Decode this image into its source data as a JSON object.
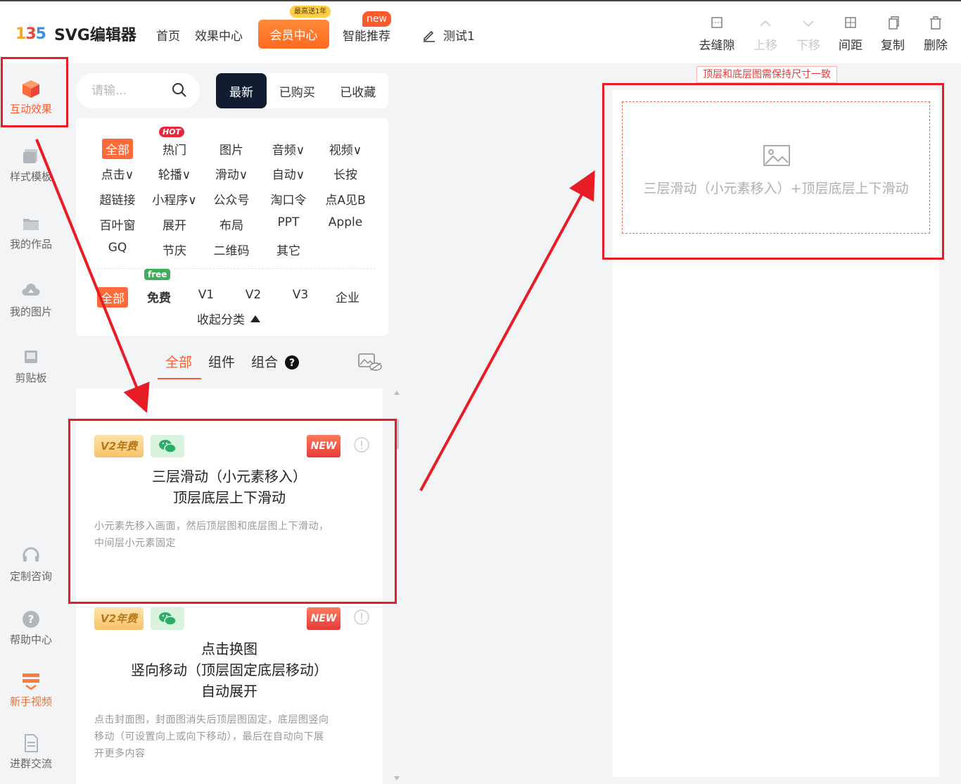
{
  "header": {
    "logo_mark": [
      "1",
      "3",
      "5"
    ],
    "logo_text": "SVG编辑器",
    "nav": [
      "首页",
      "效果中心"
    ],
    "vip_label": "会员中心",
    "vip_tag": "最高送1年",
    "smart_label": "智能推荐",
    "new_tag": "new",
    "doc_title": "测试1",
    "tools": [
      {
        "label": "去缝隙",
        "icon": "gap-icon",
        "enabled": true
      },
      {
        "label": "上移",
        "icon": "chevron-up-icon",
        "enabled": false
      },
      {
        "label": "下移",
        "icon": "chevron-down-icon",
        "enabled": false
      },
      {
        "label": "间距",
        "icon": "spacing-icon",
        "enabled": true
      },
      {
        "label": "复制",
        "icon": "copy-icon",
        "enabled": true
      },
      {
        "label": "删除",
        "icon": "trash-icon",
        "enabled": true
      }
    ]
  },
  "rail": {
    "items": [
      {
        "label": "互动效果",
        "icon": "cube-icon",
        "active": true
      },
      {
        "label": "样式模板",
        "icon": "template-icon"
      },
      {
        "label": "我的作品",
        "icon": "folder-icon"
      },
      {
        "label": "我的图片",
        "icon": "cloud-upload-icon"
      },
      {
        "label": "剪贴板",
        "icon": "clipboard-icon"
      },
      {
        "label": "定制咨询",
        "icon": "headset-icon"
      },
      {
        "label": "帮助中心",
        "icon": "help-icon"
      },
      {
        "label": "新手视频",
        "icon": "video-icon"
      },
      {
        "label": "进群交流",
        "icon": "document-icon"
      }
    ]
  },
  "panel": {
    "search_placeholder": "请输...",
    "segments": [
      "最新",
      "已购买",
      "已收藏"
    ],
    "categories": [
      [
        "全部",
        "热门",
        "图片",
        "音频∨",
        "视频∨"
      ],
      [
        "点击∨",
        "轮播∨",
        "滑动∨",
        "自动∨",
        "长按"
      ],
      [
        "超链接",
        "小程序∨",
        "公众号",
        "淘口令",
        "点A见B"
      ],
      [
        "百叶窗",
        "展开",
        "布局",
        "PPT",
        "Apple"
      ],
      [
        "GQ",
        "节庆",
        "二维码",
        "其它"
      ]
    ],
    "hot_badge": "HOT",
    "free_badge": "free",
    "price_filters": [
      "全部",
      "免费",
      "V1",
      "V2",
      "V3",
      "企业"
    ],
    "collapse_label": "收起分类",
    "type_tabs": [
      "全部",
      "组件",
      "组合"
    ],
    "cards": [
      {
        "badge_v2": "V2年费",
        "badge_new": "NEW",
        "title_lines": [
          "三层滑动（小元素移入）",
          "顶层底层上下滑动"
        ],
        "desc_lines": [
          "小元素先移入画面，然后顶层图和底层图上下滑动，",
          "中间层小元素固定"
        ]
      },
      {
        "badge_v2": "V2年费",
        "badge_new": "NEW",
        "title_lines": [
          "点击换图",
          "竖向移动（顶层固定底层移动）",
          "自动展开"
        ],
        "desc_lines": [
          "点击封面图，封面图消失后顶层图固定，底层图竖向",
          "移动（可设置向上或向下移动），最后在自动向下展",
          "开更多内容"
        ]
      }
    ]
  },
  "canvas": {
    "hint": "顶层和底层图需保持尺寸一致",
    "placeholder_text": "三层滑动（小元素移入）+顶层底层上下滑动"
  },
  "colors": {
    "accent": "#ff5a2c",
    "annotation": "#e81c24",
    "dark": "#121c30"
  }
}
